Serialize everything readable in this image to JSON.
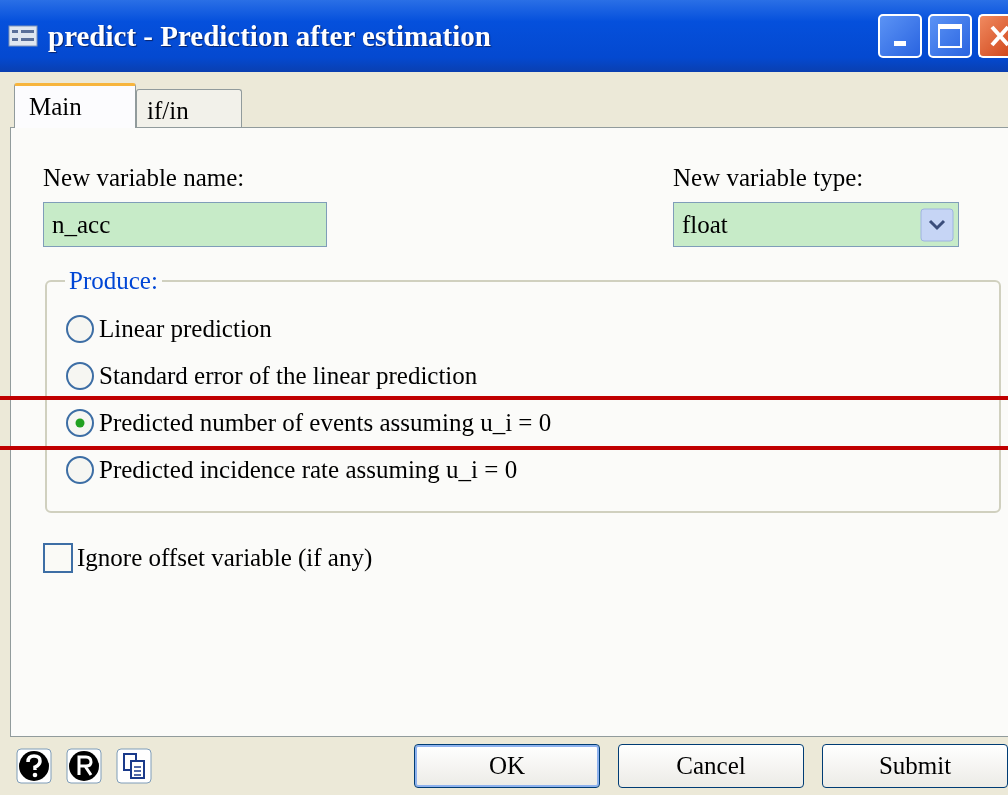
{
  "window": {
    "title": "predict - Prediction after estimation"
  },
  "tabs": [
    {
      "label": "Main",
      "selected": true
    },
    {
      "label": "if/in",
      "selected": false
    }
  ],
  "new_variable_name": {
    "label": "New variable name:",
    "value": "n_acc"
  },
  "new_variable_type": {
    "label": "New variable type:",
    "value": "float"
  },
  "produce": {
    "legend": "Produce:",
    "options": [
      {
        "label": "Linear prediction",
        "selected": false,
        "highlighted": false
      },
      {
        "label": "Standard error of the linear prediction",
        "selected": false,
        "highlighted": false
      },
      {
        "label": "Predicted number of events assuming u_i = 0",
        "selected": true,
        "highlighted": true
      },
      {
        "label": "Predicted incidence rate assuming u_i = 0",
        "selected": false,
        "highlighted": false
      }
    ]
  },
  "ignore_offset": {
    "label": "Ignore offset variable (if any)",
    "checked": false
  },
  "buttons": [
    {
      "label": "OK",
      "default": true
    },
    {
      "label": "Cancel",
      "default": false
    },
    {
      "label": "Submit",
      "default": false
    }
  ]
}
